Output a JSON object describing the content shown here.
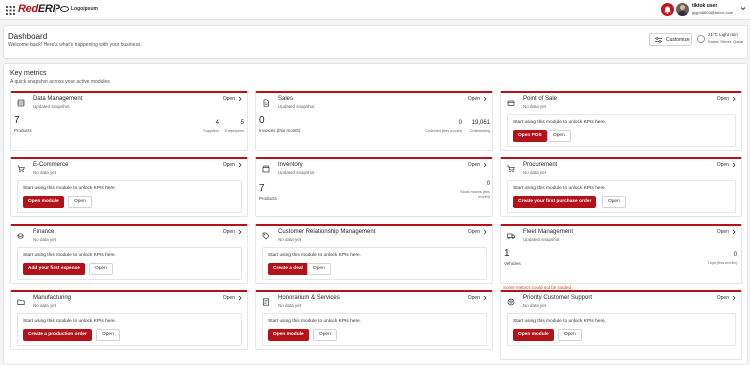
{
  "brand": {
    "name_red": "Red",
    "name_dark": "ERP",
    "partner": "Logoipsum"
  },
  "user": {
    "name": "tiktok user",
    "email": "gigph6603@btnoc.com"
  },
  "header": {
    "title": "Dashboard",
    "subtitle": "Welcome back! Here's what's happening with your business.",
    "customize_label": "Customize",
    "weather_temp": "21°C Light rain",
    "weather_location": "Kasec Street, Qatar"
  },
  "metrics": {
    "title": "Key metrics",
    "subtitle": "A quick snapshot across your active modules",
    "warning": "Some metrics could not be loaded."
  },
  "cards": [
    {
      "title": "Data Management",
      "status": "Updated snapshot",
      "open": "Open",
      "icon": "database-icon",
      "big": "7",
      "big_label": "Products",
      "stats": [
        {
          "value": "4",
          "label": "Suppliers"
        },
        {
          "value": "5",
          "label": "Employees"
        }
      ]
    },
    {
      "title": "Sales",
      "status": "Updated snapshot",
      "open": "Open",
      "icon": "document-icon",
      "big": "0",
      "big_label": "Invoices (this month)",
      "stats": [
        {
          "value": "0",
          "label": "Collected (this month)"
        },
        {
          "value": "19,061",
          "label": "Outstanding"
        }
      ]
    },
    {
      "title": "Point of Sale",
      "status": "No data yet",
      "open": "Open",
      "icon": "pos-icon",
      "message": "Start using this module to unlock KPIs here.",
      "primary": "Open POS",
      "secondary": "Open"
    },
    {
      "title": "E-Commerce",
      "status": "No data yet",
      "open": "Open",
      "icon": "cart-icon",
      "message": "Start using this module to unlock KPIs here.",
      "primary": "Open module",
      "secondary": "Open"
    },
    {
      "title": "Inventory",
      "status": "Updated snapshot",
      "open": "Open",
      "icon": "box-icon",
      "big": "7",
      "big_label": "Products",
      "stats": [
        {
          "value": "0",
          "label": "Stock moves (this month)"
        }
      ]
    },
    {
      "title": "Procurement",
      "status": "No data yet",
      "open": "Open",
      "icon": "cart-icon",
      "message": "Start using this module to unlock KPIs here.",
      "primary": "Create your first purchase order",
      "secondary": "Open"
    },
    {
      "title": "Finance",
      "status": "No data yet",
      "open": "Open",
      "icon": "finance-icon",
      "message": "Start using this module to unlock KPIs here.",
      "primary": "Add your first expense",
      "secondary": "Open"
    },
    {
      "title": "Customer Relationship Management",
      "status": "No data yet",
      "open": "Open",
      "icon": "tag-icon",
      "message": "Start using this module to unlock KPIs here.",
      "primary": "Create a deal",
      "secondary": "Open"
    },
    {
      "title": "Fleet Management",
      "status": "Updated snapshot",
      "open": "Open",
      "icon": "truck-icon",
      "big": "1",
      "big_label": "Vehicles",
      "stats": [
        {
          "value": "0",
          "label": "Trips (this month)"
        }
      ]
    },
    {
      "title": "Manufacturing",
      "status": "No data yet",
      "open": "Open",
      "icon": "folder-icon",
      "message": "Start using this module to unlock KPIs here.",
      "primary": "Create a production order",
      "secondary": "Open"
    },
    {
      "title": "Honorarium & Services",
      "status": "No data yet",
      "open": "Open",
      "icon": "services-icon",
      "message": "Start using this module to unlock KPIs here.",
      "primary": "Open module",
      "secondary": "Open"
    },
    {
      "title": "Priority Customer Support",
      "status": "No data yet",
      "open": "Open",
      "icon": "support-icon",
      "message": "Start using this module to unlock KPIs here.",
      "primary": "Open module",
      "secondary": "Open"
    }
  ]
}
